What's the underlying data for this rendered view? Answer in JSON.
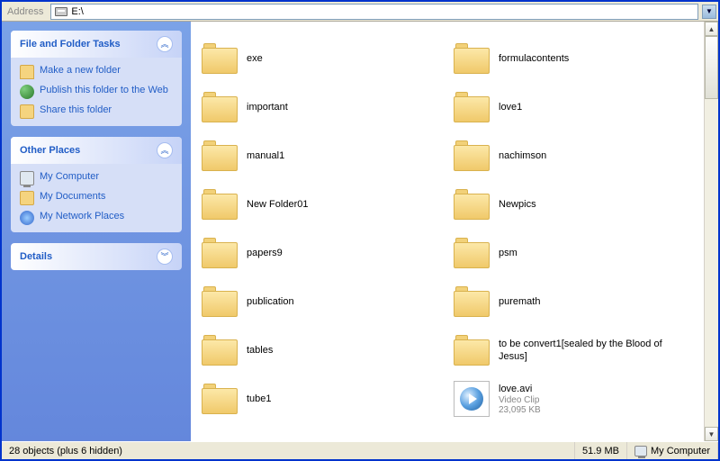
{
  "address": {
    "label": "Address",
    "path": "E:\\"
  },
  "sidebar": {
    "tasks": {
      "title": "File and Folder Tasks",
      "items": [
        {
          "icon": "folder",
          "label": "Make a new folder"
        },
        {
          "icon": "globe",
          "label": "Publish this folder to the Web"
        },
        {
          "icon": "share",
          "label": "Share this folder"
        }
      ]
    },
    "places": {
      "title": "Other Places",
      "items": [
        {
          "icon": "comp",
          "label": "My Computer"
        },
        {
          "icon": "docs",
          "label": "My Documents"
        },
        {
          "icon": "net",
          "label": "My Network Places"
        }
      ]
    },
    "details": {
      "title": "Details"
    }
  },
  "files": [
    {
      "type": "folder",
      "name": "exe"
    },
    {
      "type": "folder",
      "name": "formulacontents"
    },
    {
      "type": "folder",
      "name": "important"
    },
    {
      "type": "folder",
      "name": "love1"
    },
    {
      "type": "folder",
      "name": "manual1"
    },
    {
      "type": "folder",
      "name": "nachimson"
    },
    {
      "type": "folder",
      "name": "New Folder01"
    },
    {
      "type": "folder",
      "name": "Newpics"
    },
    {
      "type": "folder",
      "name": "papers9"
    },
    {
      "type": "folder",
      "name": "psm"
    },
    {
      "type": "folder",
      "name": "publication"
    },
    {
      "type": "folder",
      "name": "puremath"
    },
    {
      "type": "folder",
      "name": "tables"
    },
    {
      "type": "folder",
      "name": "to be convert1[sealed by the Blood of Jesus]"
    },
    {
      "type": "folder",
      "name": "tube1"
    },
    {
      "type": "video",
      "name": "love.avi",
      "kind": "Video Clip",
      "size": "23,095 KB"
    }
  ],
  "status": {
    "objects": "28 objects (plus 6 hidden)",
    "size": "51.9 MB",
    "location": "My Computer"
  }
}
